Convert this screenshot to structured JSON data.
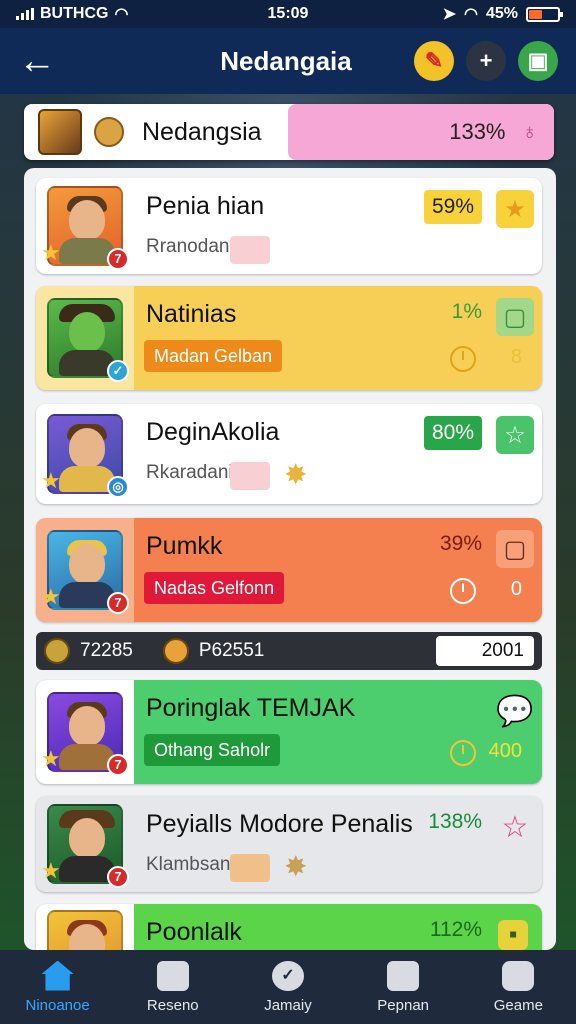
{
  "status": {
    "carrier": "BUTHCG",
    "time": "15:09",
    "battery": "45%",
    "battery_level": 0.45
  },
  "header": {
    "title": "Nedangaia",
    "action_icons": [
      "pencil-icon",
      "plus-icon",
      "gift-icon"
    ]
  },
  "leader": {
    "name": "Nedangsia",
    "percent": "133%"
  },
  "rows": [
    {
      "name": "Penia hian",
      "sub": "Rranodani",
      "percent": "59%",
      "badge": "7",
      "action": "star-icon"
    },
    {
      "name": "Natinias",
      "tag": "Madan Gelban",
      "percent": "1%",
      "count": "8",
      "action": "square-icon"
    },
    {
      "name": "DeginAkolia",
      "sub": "Rkaradani",
      "percent": "80%",
      "action": "star-outline-icon"
    },
    {
      "name": "Pumkk",
      "tag": "Nadas Gelfonn",
      "percent": "39%",
      "badge": "7",
      "count": "0",
      "action": "square-icon"
    },
    {
      "name": "Poringlak TEMJAK",
      "tag": "Othang Saholr",
      "badge": "7",
      "count": "400",
      "action": "chat-icon"
    },
    {
      "name": "Peyialls Modore Penalis",
      "sub": "Klambsan",
      "percent": "138%",
      "badge": "7",
      "action": "star-outline-icon"
    },
    {
      "name": "Poonlalk",
      "percent": "112%",
      "action": "square-icon"
    }
  ],
  "strip": {
    "left_score": "72285",
    "right_score": "P62551",
    "input_value": "2001"
  },
  "tabs": [
    {
      "label": "Ninoanoe",
      "icon": "home-icon"
    },
    {
      "label": "Reseno",
      "icon": "card-icon"
    },
    {
      "label": "Jamaiy",
      "icon": "check-icon"
    },
    {
      "label": "Pepnan",
      "icon": "list-icon"
    },
    {
      "label": "Geame",
      "icon": "game-icon"
    }
  ]
}
